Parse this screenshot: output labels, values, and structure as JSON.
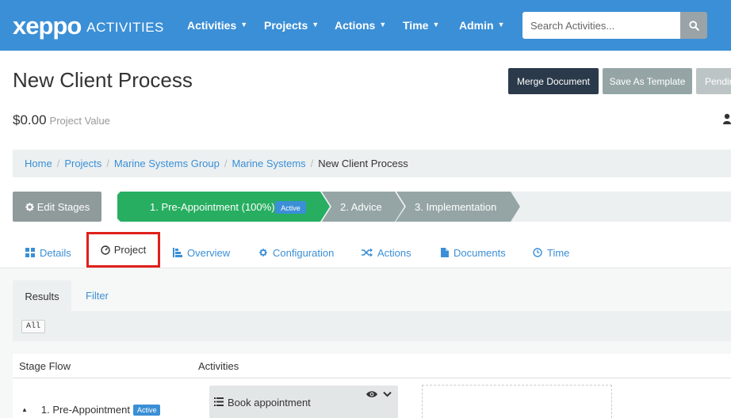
{
  "brand": {
    "logo_text": "xeppo",
    "product": "ACTIVITIES"
  },
  "nav": {
    "items": [
      {
        "label": "Activities"
      },
      {
        "label": "Projects"
      },
      {
        "label": "Actions"
      },
      {
        "label": "Time"
      },
      {
        "label": "Admin"
      }
    ],
    "search_placeholder": "Search Activities..."
  },
  "header": {
    "title": "New Client Process",
    "project_value": "$0.00",
    "project_value_label": "Project Value",
    "buttons": {
      "merge": "Merge Document",
      "template": "Save As Template",
      "pending": "Pending"
    }
  },
  "breadcrumb": {
    "items": [
      "Home",
      "Projects",
      "Marine Systems Group",
      "Marine Systems"
    ],
    "current": "New Client Process"
  },
  "stages": {
    "edit_label": "Edit Stages",
    "items": [
      {
        "label": "1. Pre-Appointment (100%)",
        "badge": "Active"
      },
      {
        "label": "2. Advice"
      },
      {
        "label": "3. Implementation"
      }
    ]
  },
  "tabs": {
    "details": "Details",
    "project": "Project",
    "overview": "Overview",
    "configuration": "Configuration",
    "actions": "Actions",
    "documents": "Documents",
    "time": "Time"
  },
  "results": {
    "subtabs": {
      "results": "Results",
      "filter": "Filter"
    },
    "filter_badge": "All",
    "columns": {
      "stage_flow": "Stage Flow",
      "activities": "Activities"
    },
    "stage_row": {
      "label": "1. Pre-Appointment",
      "badge": "Active"
    },
    "activity": {
      "label": "Book appointment"
    }
  },
  "colors": {
    "navbar": "#3b8fd6",
    "stage_active": "#27ae60",
    "stage_inactive": "#95a5a6",
    "highlight": "#e0201b"
  }
}
